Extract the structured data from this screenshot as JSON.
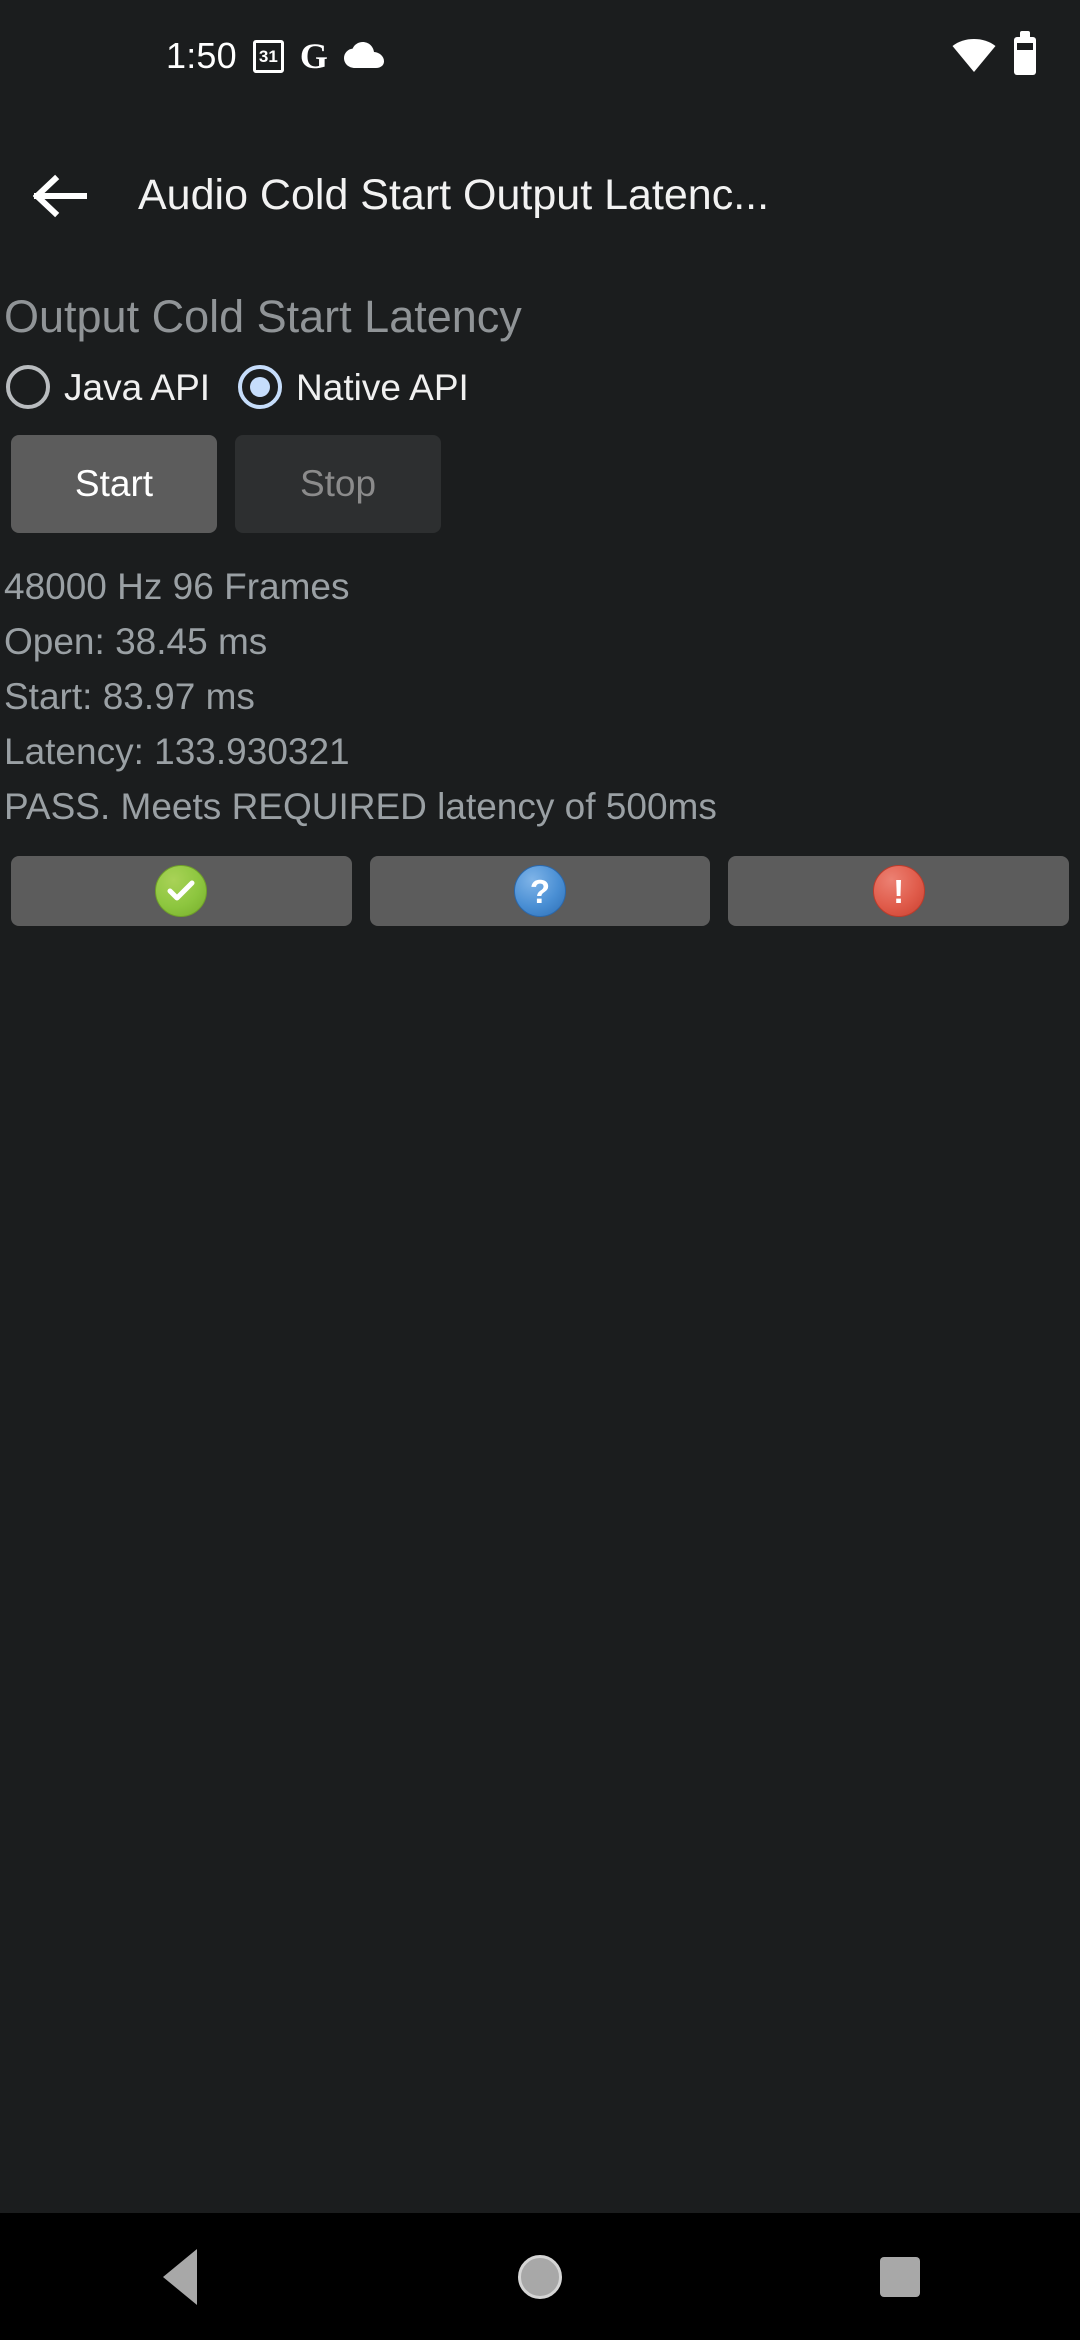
{
  "status_bar": {
    "clock": "1:50",
    "calendar_day": "31",
    "google_letter": "G",
    "icons": {
      "calendar": "calendar-icon",
      "google": "google-icon",
      "cloud": "cloud-icon",
      "wifi": "wifi-icon",
      "battery": "battery-icon"
    }
  },
  "app_bar": {
    "back_icon": "back-arrow-icon",
    "title": "Audio Cold Start Output Latenc..."
  },
  "main": {
    "section_title": "Output Cold Start Latency",
    "api_options": [
      {
        "label": "Java API",
        "selected": false
      },
      {
        "label": "Native API",
        "selected": true
      }
    ],
    "controls": {
      "start_label": "Start",
      "stop_label": "Stop",
      "start_enabled": true,
      "stop_enabled": false
    },
    "results": [
      "48000 Hz 96 Frames",
      "Open: 38.45 ms",
      "Start: 83.97 ms",
      "Latency: 133.930321",
      "PASS. Meets REQUIRED latency of 500ms"
    ],
    "verdict_buttons": [
      {
        "icon": "check-circle-icon",
        "color": "#8dc63f",
        "glyph": "✓"
      },
      {
        "icon": "question-circle-icon",
        "color": "#4a8fd4",
        "glyph": "?"
      },
      {
        "icon": "exclamation-circle-icon",
        "color": "#e05c4b",
        "glyph": "!"
      }
    ]
  },
  "nav_bar": {
    "back": "nav-back-icon",
    "home": "nav-home-icon",
    "recents": "nav-recents-icon"
  },
  "colors": {
    "background": "#1b1d1e",
    "nav_background": "#000000",
    "accent_selected": "#c6ddfb",
    "button_enabled": "#5c5c5c",
    "button_disabled": "#2d2f30",
    "text_primary": "#f0f0f0",
    "text_secondary": "#9aa0a4"
  }
}
